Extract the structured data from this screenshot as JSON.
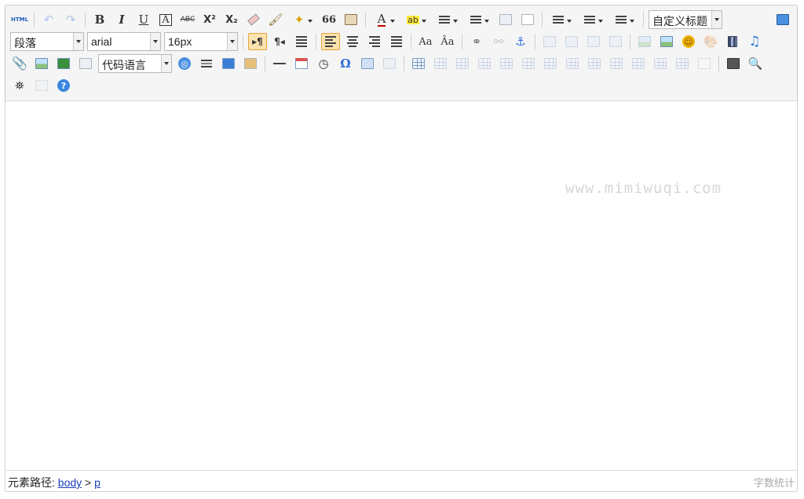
{
  "toolbar": {
    "html_label": "HTML",
    "bold": "B",
    "italic": "I",
    "underline": "U",
    "fontborder": "A",
    "strike": "ABC",
    "superscript": "X²",
    "subscript": "X₂",
    "blockquote": "66",
    "forecolor": "A",
    "backcolor": "ab",
    "custom_title": "自定义标题",
    "paragraph": "段落",
    "font_family": "arial",
    "font_size": "16px",
    "code_language": "代码语言",
    "special_char": "Ω",
    "help": "?"
  },
  "content": {
    "watermark": "www.mimiwuqi.com"
  },
  "statusbar": {
    "path_label": "元素路径: ",
    "path_body": "body",
    "path_sep": " > ",
    "path_p": "p",
    "word_count": "字数统计"
  },
  "colors": {
    "active_bg": "#fde3ae",
    "active_border": "#e6a33c",
    "link": "#1a3fb8"
  }
}
